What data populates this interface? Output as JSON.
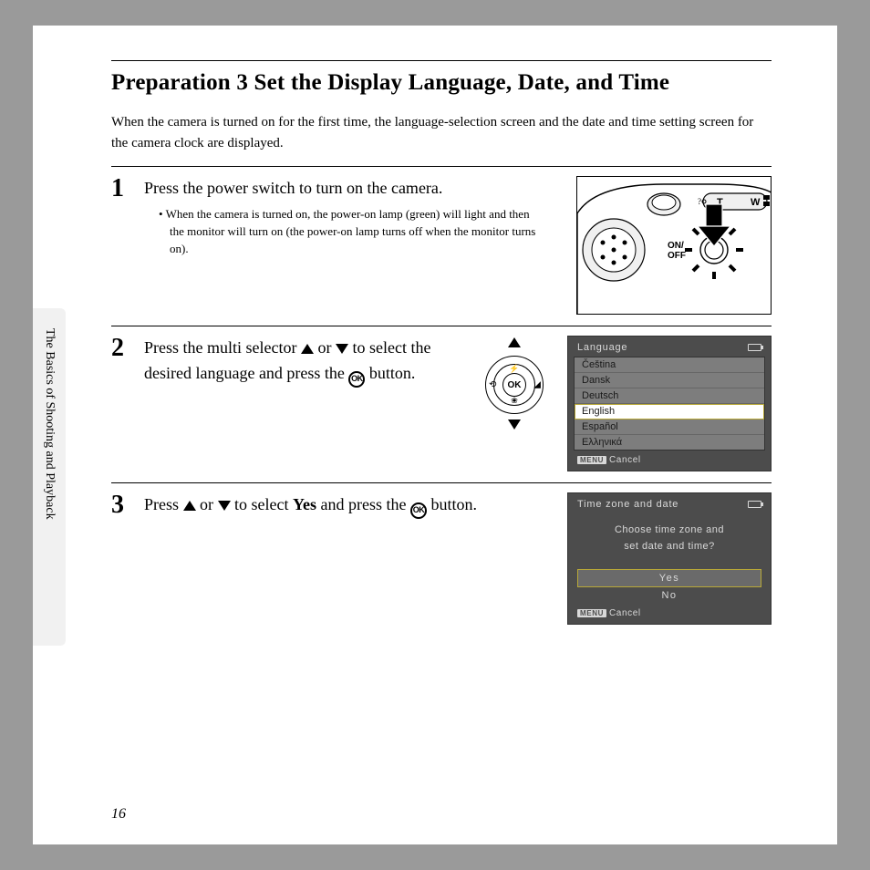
{
  "sideTab": "The Basics of Shooting and Playback",
  "title": "Preparation 3 Set the Display Language, Date, and Time",
  "intro": "When the camera is turned on for the first time, the language-selection screen and the date and time setting screen for the camera clock are displayed.",
  "steps": {
    "s1": {
      "num": "1",
      "head": "Press the power switch to turn on the camera.",
      "sub": "When the camera is turned on, the power-on lamp (green) will light and then the monitor will turn on (the power-on lamp turns off when the monitor turns on).",
      "labels": {
        "onoff": "ON/\nOFF",
        "t": "T",
        "w": "W"
      }
    },
    "s2": {
      "num": "2",
      "head_a": "Press the multi selector ",
      "head_b": " or ",
      "head_c": " to select the desired language and press the ",
      "head_d": " button.",
      "ok": "OK",
      "lcd": {
        "title": "Language",
        "items": [
          "Čeština",
          "Dansk",
          "Deutsch",
          "English",
          "Español",
          "Ελληνικά"
        ],
        "selectedIndex": 3,
        "cancel": "Cancel",
        "menu": "MENU"
      }
    },
    "s3": {
      "num": "3",
      "head_a": "Press ",
      "head_b": " or ",
      "head_c": " to select ",
      "yes": "Yes",
      "head_d": " and press the ",
      "head_e": " button.",
      "lcd": {
        "title": "Time zone and date",
        "msg1": "Choose time zone and",
        "msg2": "set date and time?",
        "optYes": "Yes",
        "optNo": "No",
        "cancel": "Cancel",
        "menu": "MENU"
      }
    }
  },
  "pageNumber": "16"
}
